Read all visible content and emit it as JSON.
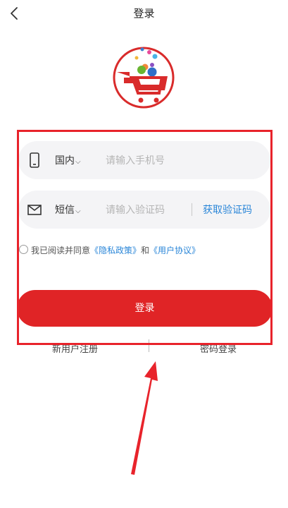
{
  "header": {
    "title": "登录",
    "back_icon": "chevron-left-icon"
  },
  "phone_field": {
    "icon": "phone-icon",
    "region": "国内",
    "placeholder": "请输入手机号"
  },
  "code_field": {
    "icon": "mail-icon",
    "method": "短信",
    "placeholder": "请输入验证码",
    "get_code": "获取验证码"
  },
  "agreement": {
    "prefix": "我已阅读并同意",
    "privacy": "《隐私政策》",
    "and": "和",
    "user_agreement": "《用户协议》"
  },
  "login_button": "登录",
  "bottom_links": {
    "register": "新用户注册",
    "password_login": "密码登录"
  },
  "colors": {
    "primary": "#e02426",
    "link": "#2a86d8",
    "annotation": "#e8232b"
  }
}
